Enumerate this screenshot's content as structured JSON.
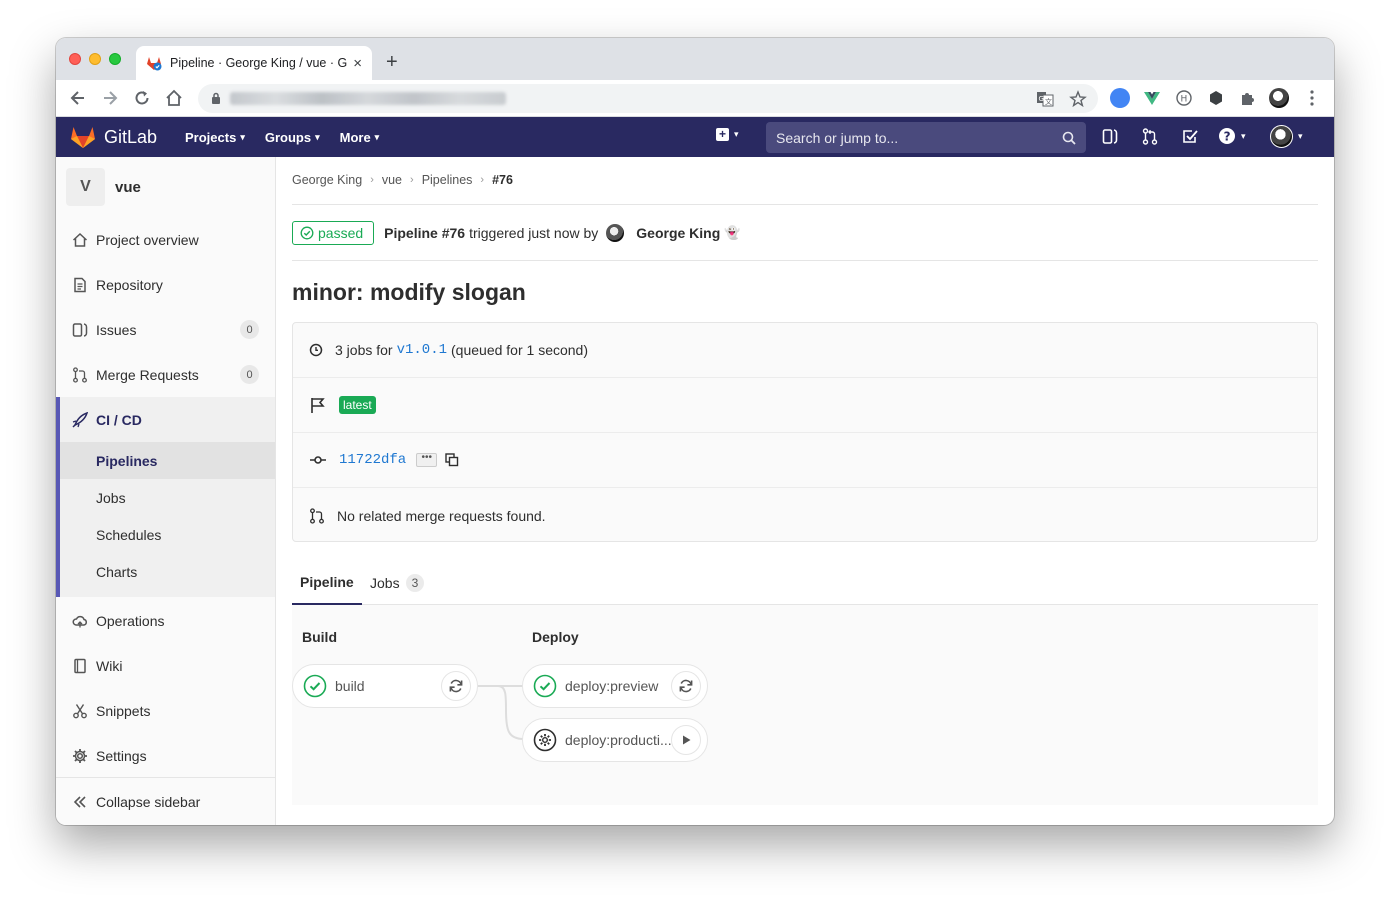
{
  "browser": {
    "tab_title": "Pipeline · George King / vue · G",
    "new_tab": "+",
    "close": "×"
  },
  "navbar": {
    "brand": "GitLab",
    "links": [
      "Projects",
      "Groups",
      "More"
    ],
    "search_placeholder": "Search or jump to...",
    "caret": "⌄"
  },
  "sidebar": {
    "project_initial": "V",
    "project_name": "vue",
    "items": [
      {
        "label": "Project overview",
        "icon": "home-icon"
      },
      {
        "label": "Repository",
        "icon": "doc-icon"
      },
      {
        "label": "Issues",
        "icon": "issues-icon",
        "badge": "0"
      },
      {
        "label": "Merge Requests",
        "icon": "merge-request-icon",
        "badge": "0"
      }
    ],
    "cicd": {
      "label": "CI / CD",
      "sub": [
        "Pipelines",
        "Jobs",
        "Schedules",
        "Charts"
      ],
      "active": "Pipelines"
    },
    "items_after": [
      {
        "label": "Operations",
        "icon": "cloud-icon"
      },
      {
        "label": "Wiki",
        "icon": "book-icon"
      },
      {
        "label": "Snippets",
        "icon": "scissors-icon"
      },
      {
        "label": "Settings",
        "icon": "gear-icon"
      }
    ],
    "collapse": "Collapse sidebar"
  },
  "breadcrumb": [
    "George King",
    "vue",
    "Pipelines",
    "#76"
  ],
  "header": {
    "status": "passed",
    "pipeline": "Pipeline #76",
    "triggered": "triggered just now by",
    "author": "George King",
    "emoji": "👻"
  },
  "title": "minor: modify slogan",
  "info": {
    "jobs_prefix": "3 jobs for",
    "ref": "v1.0.1",
    "queued": "(queued for 1 second)",
    "tag": "latest",
    "commit": "11722dfa",
    "ellipsis": "•••",
    "merge_requests": "No related merge requests found."
  },
  "tabs": {
    "pipeline": "Pipeline",
    "jobs": "Jobs",
    "jobs_count": "3"
  },
  "stages": [
    {
      "name": "Build",
      "jobs": [
        {
          "name": "build",
          "status": "success",
          "action": "retry"
        }
      ]
    },
    {
      "name": "Deploy",
      "jobs": [
        {
          "name": "deploy:preview",
          "status": "success",
          "action": "retry"
        },
        {
          "name": "deploy:producti...",
          "status": "manual",
          "action": "play"
        }
      ]
    }
  ],
  "colors": {
    "navbar": "#292961",
    "success": "#1aaa55",
    "link": "#1f78d1",
    "accent": "#5858b5"
  }
}
